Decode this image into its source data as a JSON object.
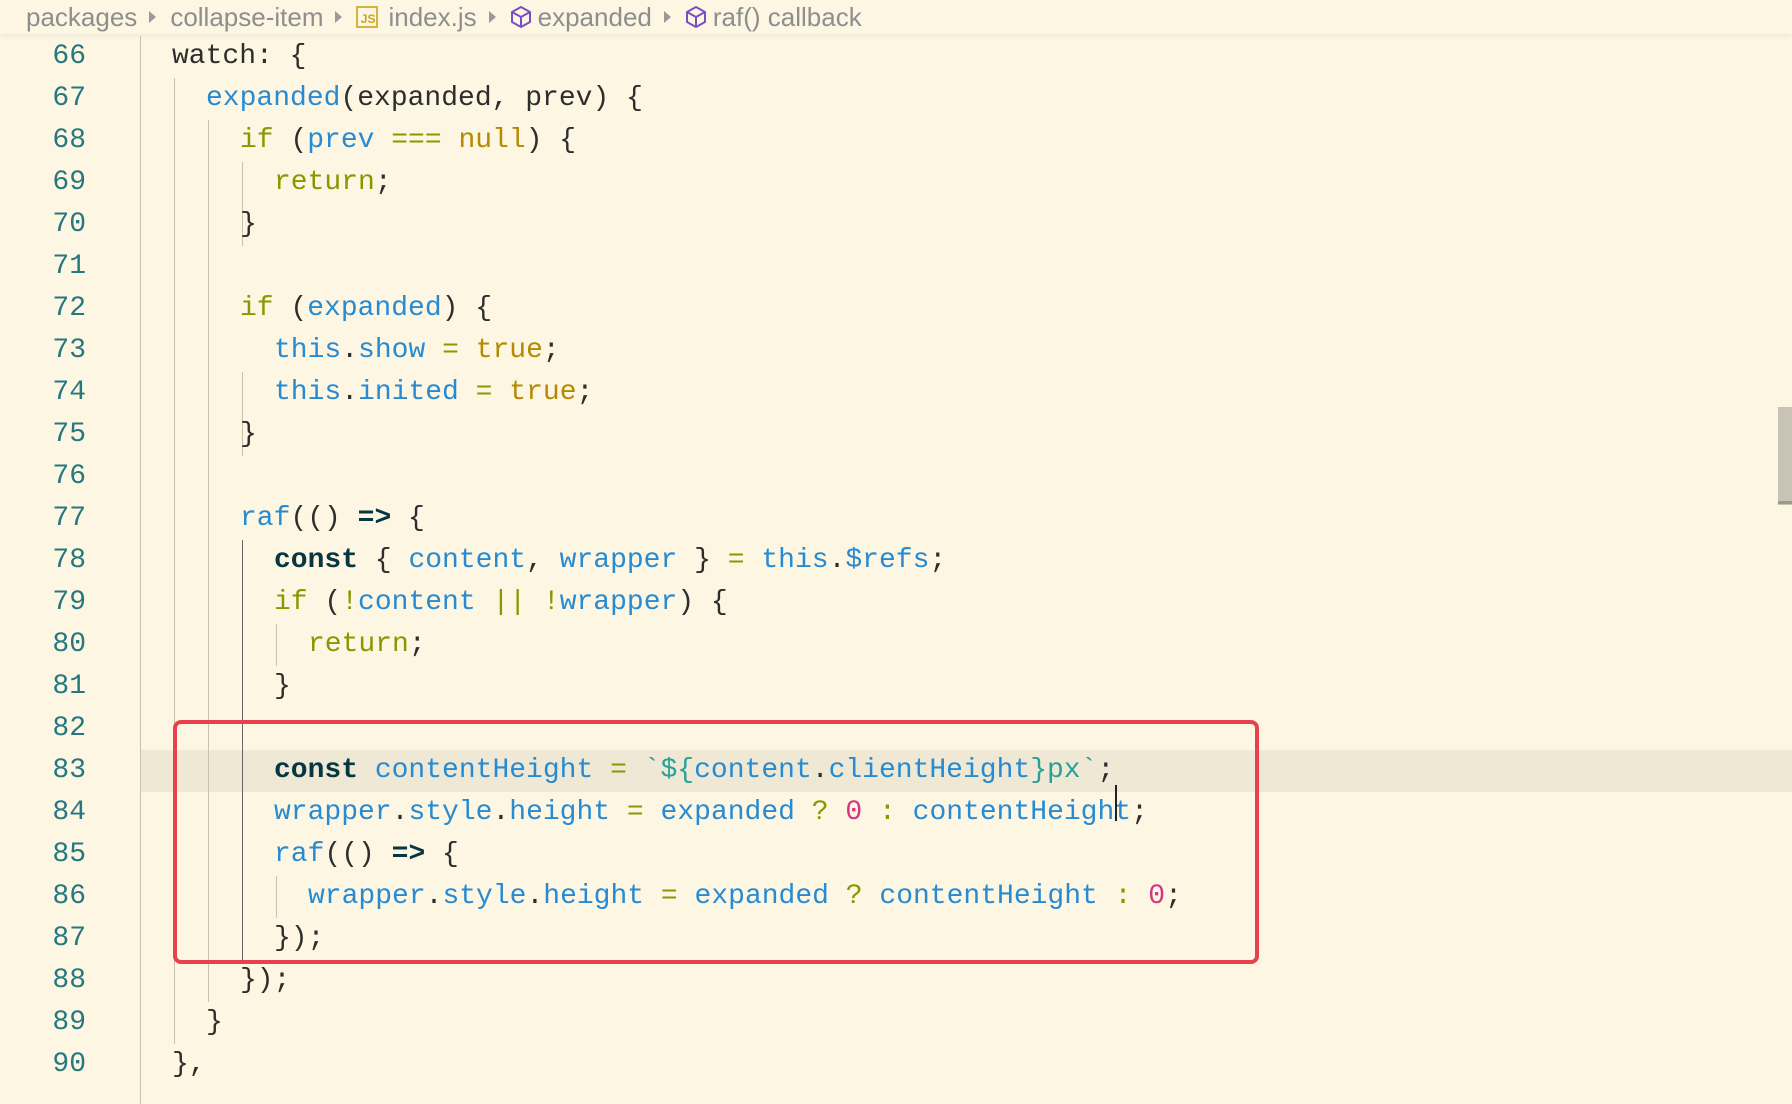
{
  "breadcrumb": {
    "items": [
      {
        "label": "packages"
      },
      {
        "label": "collapse-item"
      },
      {
        "label": "index.js",
        "icon": "js-file-icon"
      },
      {
        "label": "expanded",
        "icon": "cube-icon"
      },
      {
        "label": "raf() callback",
        "icon": "cube-icon"
      }
    ],
    "js_badge": "JS"
  },
  "editor": {
    "lines": [
      {
        "n": "66",
        "tokens": [
          [
            "pl",
            "watch: {"
          ]
        ]
      },
      {
        "n": "67",
        "tokens": [
          [
            "id",
            "expanded"
          ],
          [
            "pl",
            "(expanded, prev) {"
          ]
        ]
      },
      {
        "n": "68",
        "tokens": [
          [
            "kw",
            "if"
          ],
          [
            "pl",
            " ("
          ],
          [
            "id",
            "prev"
          ],
          [
            "pl",
            " "
          ],
          [
            "op",
            "==="
          ],
          [
            "pl",
            " "
          ],
          [
            "lit",
            "null"
          ],
          [
            "pl",
            ") {"
          ]
        ]
      },
      {
        "n": "69",
        "tokens": [
          [
            "ret",
            "return"
          ],
          [
            "pl",
            ";"
          ]
        ]
      },
      {
        "n": "70",
        "tokens": [
          [
            "pl",
            "}"
          ]
        ]
      },
      {
        "n": "71",
        "tokens": []
      },
      {
        "n": "72",
        "tokens": [
          [
            "kw",
            "if"
          ],
          [
            "pl",
            " ("
          ],
          [
            "id",
            "expanded"
          ],
          [
            "pl",
            ") {"
          ]
        ]
      },
      {
        "n": "73",
        "tokens": [
          [
            "id",
            "this"
          ],
          [
            "pl",
            "."
          ],
          [
            "id",
            "show"
          ],
          [
            "pl",
            " "
          ],
          [
            "op",
            "="
          ],
          [
            "pl",
            " "
          ],
          [
            "lit",
            "true"
          ],
          [
            "pl",
            ";"
          ]
        ]
      },
      {
        "n": "74",
        "tokens": [
          [
            "id",
            "this"
          ],
          [
            "pl",
            "."
          ],
          [
            "id",
            "inited"
          ],
          [
            "pl",
            " "
          ],
          [
            "op",
            "="
          ],
          [
            "pl",
            " "
          ],
          [
            "lit",
            "true"
          ],
          [
            "pl",
            ";"
          ]
        ]
      },
      {
        "n": "75",
        "tokens": [
          [
            "pl",
            "}"
          ]
        ]
      },
      {
        "n": "76",
        "tokens": []
      },
      {
        "n": "77",
        "tokens": [
          [
            "id",
            "raf"
          ],
          [
            "pl",
            "(() "
          ],
          [
            "kwb",
            "=>"
          ],
          [
            "pl",
            " {"
          ]
        ]
      },
      {
        "n": "78",
        "tokens": [
          [
            "kwb",
            "const"
          ],
          [
            "pl",
            " { "
          ],
          [
            "id",
            "content"
          ],
          [
            "pl",
            ", "
          ],
          [
            "id",
            "wrapper"
          ],
          [
            "pl",
            " } "
          ],
          [
            "op",
            "="
          ],
          [
            "pl",
            " "
          ],
          [
            "id",
            "this"
          ],
          [
            "pl",
            "."
          ],
          [
            "id",
            "$refs"
          ],
          [
            "pl",
            ";"
          ]
        ]
      },
      {
        "n": "79",
        "tokens": [
          [
            "kw",
            "if"
          ],
          [
            "pl",
            " ("
          ],
          [
            "op",
            "!"
          ],
          [
            "id",
            "content"
          ],
          [
            "pl",
            " "
          ],
          [
            "op",
            "||"
          ],
          [
            "pl",
            " "
          ],
          [
            "op",
            "!"
          ],
          [
            "id",
            "wrapper"
          ],
          [
            "pl",
            ") {"
          ]
        ]
      },
      {
        "n": "80",
        "tokens": [
          [
            "ret",
            "return"
          ],
          [
            "pl",
            ";"
          ]
        ]
      },
      {
        "n": "81",
        "tokens": [
          [
            "pl",
            "}"
          ]
        ]
      },
      {
        "n": "82",
        "tokens": []
      },
      {
        "n": "83",
        "tokens": [
          [
            "kwb",
            "const"
          ],
          [
            "pl",
            " "
          ],
          [
            "id",
            "contentHeight"
          ],
          [
            "pl",
            " "
          ],
          [
            "op",
            "="
          ],
          [
            "pl",
            " "
          ],
          [
            "str",
            "`${"
          ],
          [
            "id",
            "content"
          ],
          [
            "pl",
            "."
          ],
          [
            "id",
            "clientHeight"
          ],
          [
            "str",
            "}px`"
          ],
          [
            "pl",
            ";"
          ]
        ]
      },
      {
        "n": "84",
        "tokens": [
          [
            "id",
            "wrapper"
          ],
          [
            "pl",
            "."
          ],
          [
            "id",
            "style"
          ],
          [
            "pl",
            "."
          ],
          [
            "id",
            "height"
          ],
          [
            "pl",
            " "
          ],
          [
            "op",
            "="
          ],
          [
            "pl",
            " "
          ],
          [
            "id",
            "expanded"
          ],
          [
            "pl",
            " "
          ],
          [
            "op",
            "?"
          ],
          [
            "pl",
            " "
          ],
          [
            "num",
            "0"
          ],
          [
            "pl",
            " "
          ],
          [
            "op",
            ":"
          ],
          [
            "pl",
            " "
          ],
          [
            "id",
            "contentHeight"
          ],
          [
            "pl",
            ";"
          ]
        ]
      },
      {
        "n": "85",
        "tokens": [
          [
            "id",
            "raf"
          ],
          [
            "pl",
            "(() "
          ],
          [
            "kwb",
            "=>"
          ],
          [
            "pl",
            " {"
          ]
        ]
      },
      {
        "n": "86",
        "tokens": [
          [
            "id",
            "wrapper"
          ],
          [
            "pl",
            "."
          ],
          [
            "id",
            "style"
          ],
          [
            "pl",
            "."
          ],
          [
            "id",
            "height"
          ],
          [
            "pl",
            " "
          ],
          [
            "op",
            "="
          ],
          [
            "pl",
            " "
          ],
          [
            "id",
            "expanded"
          ],
          [
            "pl",
            " "
          ],
          [
            "op",
            "?"
          ],
          [
            "pl",
            " "
          ],
          [
            "id",
            "contentHeight"
          ],
          [
            "pl",
            " "
          ],
          [
            "op",
            ":"
          ],
          [
            "pl",
            " "
          ],
          [
            "num",
            "0"
          ],
          [
            "pl",
            ";"
          ]
        ]
      },
      {
        "n": "87",
        "tokens": [
          [
            "pl",
            "});"
          ]
        ]
      },
      {
        "n": "88",
        "tokens": [
          [
            "pl",
            "});"
          ]
        ]
      },
      {
        "n": "89",
        "tokens": [
          [
            "pl",
            "}"
          ]
        ]
      },
      {
        "n": "90",
        "tokens": [
          [
            "pl",
            "},"
          ]
        ]
      }
    ],
    "current_line": "83"
  },
  "colors": {
    "background": "#fdf6e3",
    "current_line": "#eee8d5",
    "annotation_border": "#e8404e",
    "line_number": "#257880"
  }
}
